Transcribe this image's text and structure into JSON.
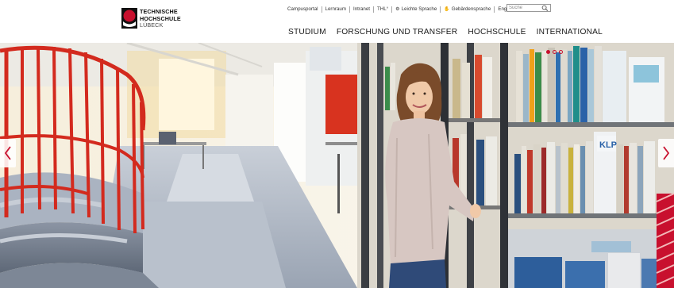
{
  "brand": {
    "line1": "TECHNISCHE",
    "line2": "HOCHSCHULE",
    "line3": "LÜBECK",
    "accent": "#c8102e"
  },
  "utility_nav": {
    "items": [
      {
        "label": "Campusportal"
      },
      {
        "label": "Lernraum"
      },
      {
        "label": "Intranet"
      },
      {
        "label": "THL°"
      },
      {
        "label": "Leichte Sprache",
        "icon": "easy-language-icon"
      },
      {
        "label": "Gebärdensprache",
        "icon": "sign-language-icon"
      },
      {
        "label": "English"
      }
    ]
  },
  "search": {
    "placeholder": "Suche",
    "icon": "search-icon"
  },
  "main_nav": {
    "items": [
      {
        "label": "STUDIUM"
      },
      {
        "label": "FORSCHUNG UND TRANSFER"
      },
      {
        "label": "HOCHSCHULE"
      },
      {
        "label": "INTERNATIONAL"
      }
    ]
  },
  "slider": {
    "slide_count": 3,
    "active_slide": 1,
    "prev_icon": "chevron-left-icon",
    "next_icon": "chevron-right-icon",
    "shelf_label": "KLP"
  }
}
